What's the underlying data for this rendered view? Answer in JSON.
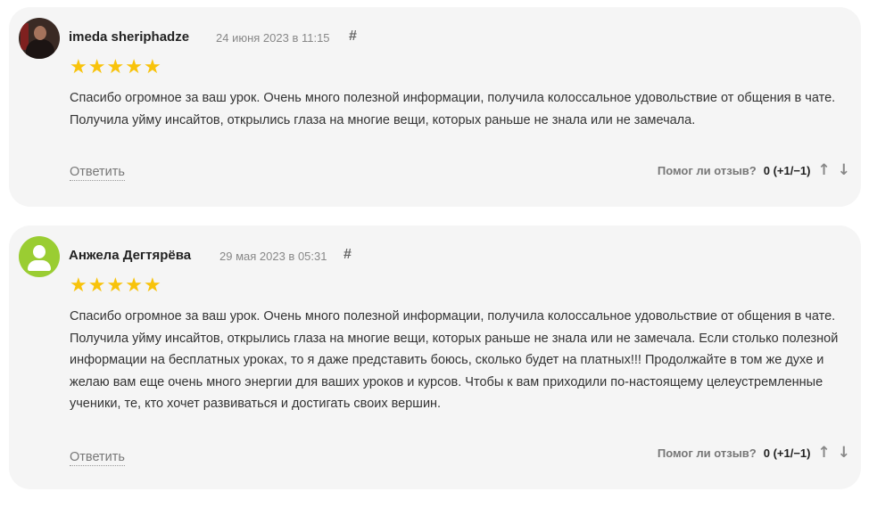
{
  "reviews": [
    {
      "author": "imeda sheriphadze",
      "date": "24 июня 2023 в 11:15",
      "hash": "#",
      "rating": 5,
      "star_glyph": "★",
      "text": "Спасибо огромное за ваш урок. Очень много полезной информации, получила колоссальное удовольствие от общения в чате. Получила уйму инсайтов, открылись глаза на многие вещи, которых раньше не знала или не замечала.",
      "reply_label": "Ответить",
      "helpful_label": "Помог ли отзыв?",
      "helpful_count": "0 (+1/−1)",
      "upvote_icon": "arrow-up-icon",
      "downvote_icon": "arrow-down-icon",
      "upvote_glyph": "↑",
      "downvote_glyph": "↓"
    },
    {
      "author": "Анжела Дегтярёва",
      "date": "29 мая 2023 в 05:31",
      "hash": "#",
      "rating": 5,
      "star_glyph": "★",
      "text": "Спасибо огромное за ваш урок. Очень много полезной информации, получила колоссальное удовольствие от общения в чате. Получила уйму инсайтов, открылись глаза на многие вещи, которых раньше не знала или не замечала. Если столько полезной информации на бесплатных уроках, то я даже представить боюсь, сколько будет на платных!!! Продолжайте в том же духе и желаю вам еще очень много энергии для ваших уроков и курсов. Чтобы к вам приходили по-настоящему целеустремленные ученики, те, кто хочет развиваться и достигать своих вершин.",
      "reply_label": "Ответить",
      "helpful_label": "Помог ли отзыв?",
      "helpful_count": "0 (+1/−1)",
      "upvote_icon": "arrow-up-icon",
      "downvote_icon": "arrow-down-icon",
      "upvote_glyph": "↑",
      "downvote_glyph": "↓"
    }
  ],
  "colors": {
    "card_bg": "#f5f5f5",
    "star": "#f8c30b",
    "generic_avatar": "#9acd32"
  }
}
